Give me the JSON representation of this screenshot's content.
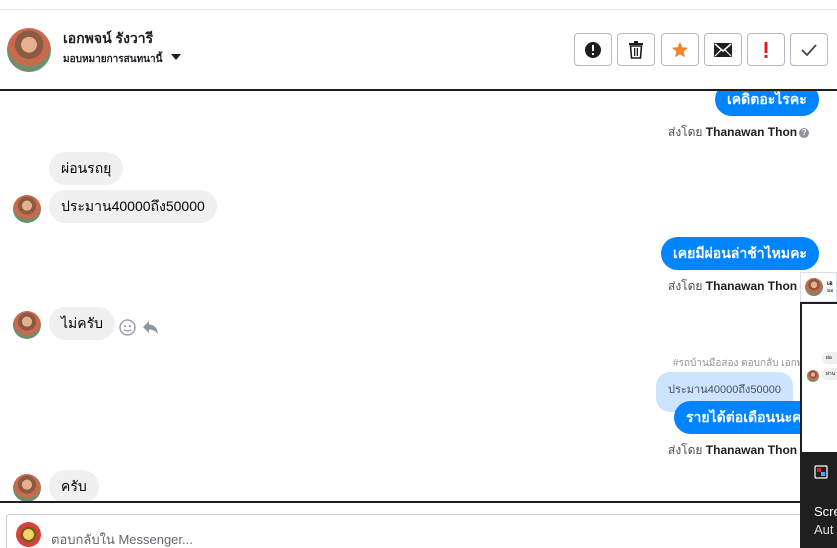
{
  "header": {
    "name": "เอกพจน์ รังวารี",
    "assign_label": "มอบหมายการสนทนานี้",
    "buttons": [
      {
        "name": "alert-circle-button",
        "icon": "exclamation-circle-icon"
      },
      {
        "name": "delete-button",
        "icon": "trash-icon"
      },
      {
        "name": "star-button",
        "icon": "star-icon"
      },
      {
        "name": "mail-button",
        "icon": "envelope-icon"
      },
      {
        "name": "important-button",
        "icon": "exclamation-icon"
      },
      {
        "name": "done-button",
        "icon": "checkmark-icon"
      }
    ]
  },
  "thread": {
    "messages": [
      {
        "from": "agent",
        "text": "เคดิตอะไรคะ"
      },
      {
        "sent_by_prefix": "ส่งโดย",
        "sent_by_name": "Thanawan Thon"
      },
      {
        "from": "customer",
        "text": "ผ่อนรถยุ"
      },
      {
        "from": "customer",
        "text": "ประมาน40000ถึง50000"
      },
      {
        "from": "agent",
        "text": "เคยมีผ่อนล่าช้าไหมคะ"
      },
      {
        "sent_by_prefix": "ส่งโดย",
        "sent_by_name": "Thanawan Thon"
      },
      {
        "from": "customer",
        "text": "ไม่ครับ"
      },
      {
        "reply_note": "#รถบ้านมือสอง ตอบกลับ เอกพ"
      },
      {
        "quoted": "ประมาน40000ถึง50000"
      },
      {
        "from": "agent",
        "text": "รายได้ต่อเดือนนะคะ"
      },
      {
        "sent_by_prefix": "ส่งโดย",
        "sent_by_name": "Thanawan Thon"
      },
      {
        "from": "customer",
        "text": "ครับ"
      }
    ]
  },
  "composer": {
    "placeholder": "ตอบกลับใน Messenger..."
  },
  "side_panel": {
    "header_text": "เอ",
    "sub_text": "มอ",
    "bubble_1": "ผ่อ",
    "bubble_2": "ผ่าน",
    "title": "Scre",
    "subtitle": "Aut"
  },
  "colors": {
    "agent_bubble": "#0084ff",
    "customer_bubble": "#f0f0f0",
    "star": "#f5832b",
    "important": "#e02020"
  }
}
